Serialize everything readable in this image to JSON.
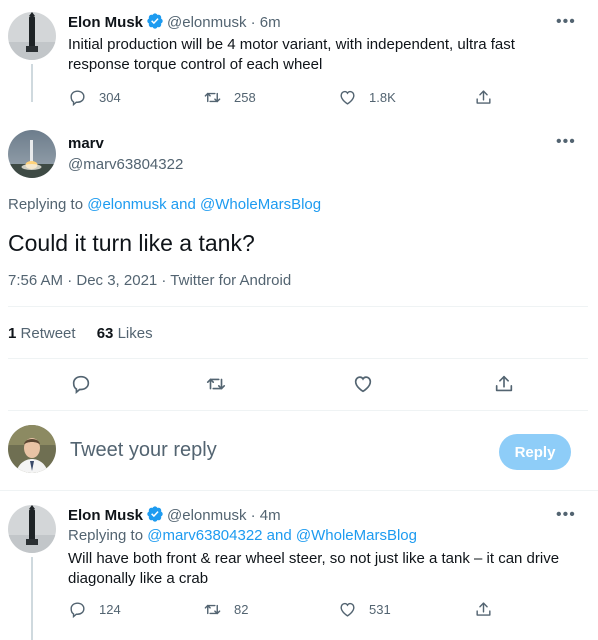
{
  "tweet1": {
    "name": "Elon Musk",
    "handle": "@elonmusk",
    "time": "6m",
    "text_line1": "Initial production will be 4 motor variant, with independent, ultra fast",
    "text_line2": "response torque control of each wheel",
    "replies": "304",
    "retweets": "258",
    "likes": "1.8K"
  },
  "main": {
    "name": "marv",
    "handle": "@marv63804322",
    "replying_prefix": "Replying to",
    "replying_to": "@elonmusk and @WholeMarsBlog",
    "text": "Could it turn like a tank?",
    "timestamp": "7:56 AM · Dec 3, 2021 · Twitter for Android",
    "retweet_count": "1",
    "retweet_label": "Retweet",
    "like_count": "63",
    "like_label": "Likes"
  },
  "compose": {
    "placeholder": "Tweet your reply",
    "button_label": "Reply"
  },
  "tweet2": {
    "name": "Elon Musk",
    "handle": "@elonmusk",
    "time": "4m",
    "replying_prefix": "Replying to",
    "replying_to": "@marv63804322 and @WholeMarsBlog",
    "text_line1": "Will have both front & rear wheel steer, so not just like a tank – it can drive",
    "text_line2": "diagonally like a crab",
    "replies": "124",
    "retweets": "82",
    "likes": "531"
  },
  "colors": {
    "accent": "#1d9bf0",
    "reply_button": "#8ecdf8",
    "text": "#0f1419",
    "muted": "#536471",
    "divider": "#eff3f4"
  },
  "icons": [
    "verified-badge-icon",
    "reply-icon",
    "retweet-icon",
    "like-icon",
    "share-icon",
    "more-icon"
  ]
}
